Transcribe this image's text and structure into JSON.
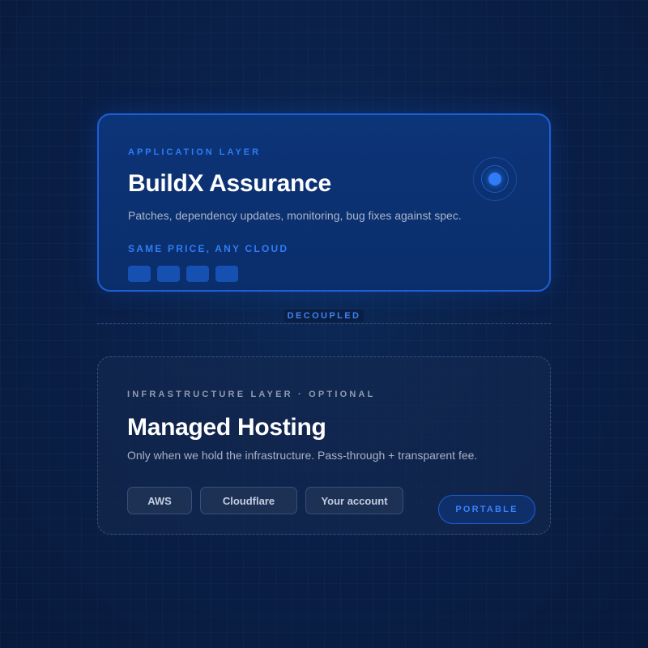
{
  "application_card": {
    "eyebrow": "APPLICATION LAYER",
    "title": "BuildX Assurance",
    "description": "Patches, dependency updates, monitoring, bug fixes against spec.",
    "price_label": "SAME PRICE, ANY CLOUD",
    "status_icon": "beacon-icon",
    "accent_color": "#2f7cf6"
  },
  "separator": {
    "label": "DECOUPLED"
  },
  "infrastructure_card": {
    "eyebrow": "INFRASTRUCTURE LAYER · OPTIONAL",
    "title": "Managed Hosting",
    "description": "Only when we hold the infrastructure. Pass-through + transparent fee.",
    "providers": [
      "AWS",
      "Cloudflare",
      "Your account"
    ],
    "badge": "PORTABLE"
  }
}
